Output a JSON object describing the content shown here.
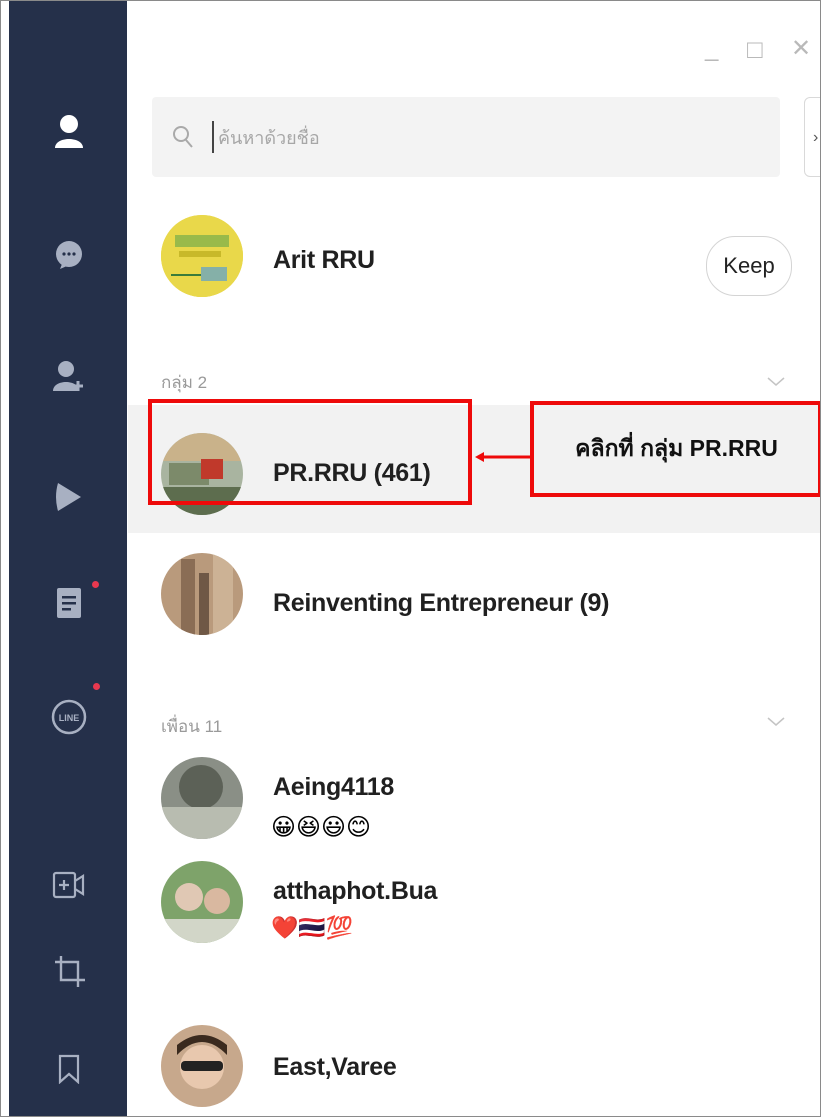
{
  "window": {
    "minimize_glyph": "_",
    "maximize_glyph": "□",
    "close_glyph": "✕"
  },
  "sidebar": {
    "icons": [
      "person-icon",
      "chat-icon",
      "add-friend-icon",
      "timeline-icon",
      "news-icon",
      "line-today-icon",
      "video-call-icon",
      "crop-icon",
      "bookmark-icon"
    ],
    "line_badge_text": "LINE"
  },
  "search": {
    "placeholder": "ค้นหาด้วยชื่อ",
    "expand_glyph": "›"
  },
  "profile": {
    "name": "Arit RRU",
    "keep_label": "Keep"
  },
  "groups": {
    "section_label": "กลุ่ม 2",
    "items": [
      {
        "name": "PR.RRU (461)"
      },
      {
        "name": "Reinventing Entrepreneur (9)"
      }
    ]
  },
  "friends": {
    "section_label": "เพื่อน 11",
    "items": [
      {
        "name": "Aeing4118",
        "status": "😀😆😃😊"
      },
      {
        "name": "atthaphot.Bua",
        "status": "❤️🇹🇭💯"
      },
      {
        "name": "East,Varee",
        "status": ""
      }
    ]
  },
  "annotation": {
    "callout_text": "คลิกที่ กลุ่ม PR.RRU",
    "color": "#ee0a0a"
  },
  "colors": {
    "sidebar_bg": "#25304a",
    "selected_row_bg": "#f2f2f2"
  }
}
